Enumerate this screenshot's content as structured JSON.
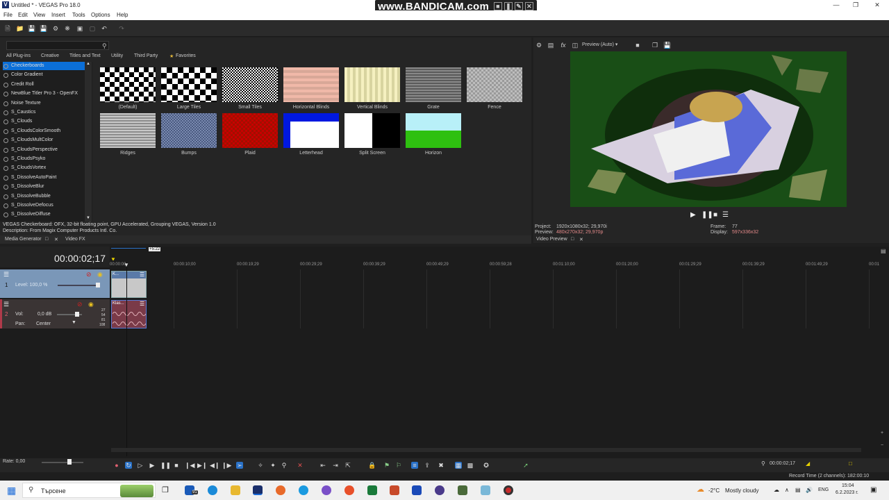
{
  "titlebar": {
    "title": "Untitled * - VEGAS Pro 18.0",
    "app_icon": "V"
  },
  "menu": [
    "File",
    "Edit",
    "View",
    "Insert",
    "Tools",
    "Options",
    "Help"
  ],
  "bandicam": {
    "text": "www.BANDICAM.com"
  },
  "plugins": {
    "tabs": [
      "All Plug-ins",
      "Creative",
      "Titles and Text",
      "Utility",
      "Third Party",
      "Favorites"
    ],
    "list": [
      "Checkerboards",
      "Color Gradient",
      "Credit Roll",
      "NewBlue Titler Pro 3 - OpenFX",
      "Noise Texture",
      "S_Caustics",
      "S_Clouds",
      "S_CloudsColorSmooth",
      "S_CloudsMultColor",
      "S_CloudsPerspective",
      "S_CloudsPsyko",
      "S_CloudsVortex",
      "S_DissolveAutoPaint",
      "S_DissolveBlur",
      "S_DissolveBubble",
      "S_DissolveDefocus",
      "S_DissolveDiffuse"
    ],
    "presets": [
      "(Default)",
      "Large Tiles",
      "Small Tiles",
      "Horizontal Blinds",
      "Vertical Blinds",
      "Grate",
      "Fence",
      "Ridges",
      "Bumps",
      "Plaid",
      "Letterhead",
      "Split Screen",
      "Horizon"
    ],
    "description_line1": "VEGAS Checkerboard: OFX, 32-bit floating point, GPU Accelerated, Grouping VEGAS, Version 1.0",
    "description_line2": "Description: From Magix Computer Products Intl. Co.",
    "window_tabs": [
      "Media Generator",
      "Video FX"
    ]
  },
  "preview": {
    "mode": "Preview (Auto)",
    "project_label": "Project:",
    "project_value": "1920x1080x32; 29,970i",
    "preview_label": "Preview:",
    "preview_value": "480x270x32; 29,970p",
    "frame_label": "Frame:",
    "frame_value": "77",
    "display_label": "Display:",
    "display_value": "597x336x32",
    "window_tab": "Video Preview"
  },
  "timeline": {
    "timecode": "00:00:02;17",
    "region_marker": "+5:22",
    "ticks": [
      "00:00:00",
      "00:00:10;00",
      "00:00:19;29",
      "00:00:29;29",
      "00:00:39;29",
      "00:00:49;29",
      "00:00:59;28",
      "00:01:10;00",
      "00:01:20;00",
      "00:01:29;29",
      "00:01:39;29",
      "00:01:49;29",
      "00:01"
    ],
    "track1": {
      "number": "1",
      "level": "Level: 100,0 %",
      "clip": "K..."
    },
    "track2": {
      "number": "2",
      "vol_label": "Vol:",
      "vol_value": "0,0 dB",
      "pan_label": "Pan:",
      "pan_value": "Center",
      "clip": "Klas...",
      "meter_ticks": [
        "27",
        "54",
        "81",
        "108"
      ]
    }
  },
  "transport": {
    "rate": "Rate: 0,00",
    "end_time": "00:00:02;17"
  },
  "status": {
    "record_time": "Record Time (2 channels): 182:00:10"
  },
  "taskbar": {
    "search": "Търсене",
    "weather_temp": "-2°C",
    "weather_text": "Mostly cloudy",
    "lang": "ENG",
    "time": "15:04",
    "date": "6.2.2023 г.",
    "mail_badge": "91"
  }
}
